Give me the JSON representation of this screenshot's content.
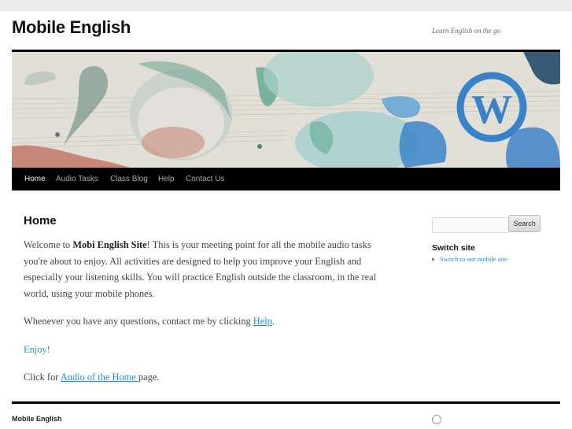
{
  "header": {
    "site_title": "Mobile English",
    "site_description": "Learn English on the go"
  },
  "nav": {
    "items": [
      {
        "label": "Home",
        "current": true
      },
      {
        "label": "Audio Tasks"
      },
      {
        "label": "Class Blog"
      },
      {
        "label": "Help"
      },
      {
        "label": "Contact Us"
      }
    ]
  },
  "main": {
    "title": "Home",
    "p1_prefix": "Welcome to ",
    "p1_bold": "Mobi English Site",
    "p1_suffix": "! This is your meeting point for all the mobile audio tasks you're about to enjoy. All activities are designed to help you improve your English and especially your listening skills.  You will practice English outside the classroom, in the real world, using your mobile phones.",
    "p2_prefix": "Whenever you have any questions, contact me by clicking ",
    "p2_link": "Help",
    "p2_suffix": ".",
    "p3": "Enjoy!",
    "p4_prefix": "Click for ",
    "p4_link": "Audio of the Home ",
    "p4_suffix": "page."
  },
  "sidebar": {
    "search_placeholder": "",
    "search_button": "Search",
    "widget_title": "Switch site",
    "widget_link": "Switch to our mobile site"
  },
  "footer": {
    "site_title": "Mobile English"
  }
}
